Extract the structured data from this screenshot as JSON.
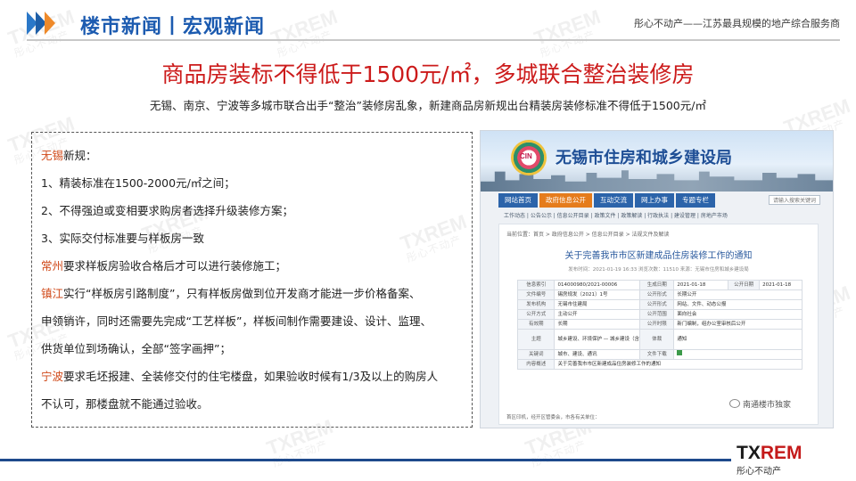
{
  "header": {
    "title": "楼市新闻丨宏观新闻",
    "slogan": "彤心不动产——江苏最具规模的地产综合服务商"
  },
  "main_title": "商品房装标不得低于1500元/㎡，多城联合整治装修房",
  "subtitle": "无锡、南京、宁波等多城市联合出手“整治”装修房乱象，新建商品房新规出台精装房装修标准不得低于1500元/㎡",
  "content": {
    "lines": [
      {
        "city": "无锡",
        "text": "新规："
      },
      {
        "city": "",
        "text": "1、精装标准在1500-2000元/㎡之间；"
      },
      {
        "city": "",
        "text": "2、不得强迫或变相要求购房者选择升级装修方案；"
      },
      {
        "city": "",
        "text": "3、实际交付标准要与样板房一致"
      },
      {
        "city": "常州",
        "text": "要求样板房验收合格后才可以进行装修施工；"
      },
      {
        "city": "镇江",
        "text": "实行“样板房引路制度”，只有样板房做到位开发商才能进一步价格备案、"
      },
      {
        "city": "",
        "text": "申领销许，同时还需要先完成“工艺样板”，样板间制作需要建设、设计、监理、"
      },
      {
        "city": "",
        "text": "供货单位到场确认，全部“签字画押”；"
      },
      {
        "city": "宁波",
        "text": "要求毛坯报建、全装修交付的住宅楼盘，如果验收时候有1/3及以上的购房人"
      },
      {
        "city": "",
        "text": "不认可，那楼盘就不能通过验收。"
      }
    ]
  },
  "screenshot": {
    "logo_text": "CIN",
    "site_title": "无锡市住房和城乡建设局",
    "nav": [
      "网站首页",
      "政府信息公开",
      "互动交流",
      "网上办事",
      "专题专栏"
    ],
    "search_placeholder": "请输入搜索关键词",
    "subnav": "工作动态 | 公告公示 | 信息公开目录 | 政策文件 | 政策解读 | 行政执法 | 建设管理 | 房地产市场",
    "breadcrumb": "当前位置：首页 > 政府信息公开 > 信息公开目录 > 法规文件及解读",
    "notice_title": "关于完善我市市区新建成品住房装修工作的通知",
    "meta": "发布时间：2021-01-19 16:33   浏览次数：11510   来源：无锡市住房和城乡建设局",
    "table": [
      [
        "信息索引",
        "014000980/2021-00006",
        "生成日期",
        "2021-01-18",
        "公开日期",
        "2021-01-18"
      ],
      [
        "文件编号",
        "锡房规发〔2021〕1号",
        "公开形式",
        "长期公开",
        "",
        ""
      ],
      [
        "发布机构",
        "无锡市住建局",
        "公开形式",
        "网站、文件、动态公报",
        "",
        ""
      ],
      [
        "公开方式",
        "主动公开",
        "公开范围",
        "面向社会",
        "",
        ""
      ],
      [
        "有效期",
        "长期",
        "公开时限",
        "新门编制，组办公室审核后公开",
        "",
        ""
      ],
      [
        "主题",
        "城乡建设、环境保护 — 城乡建设（含住房）",
        "体裁",
        "通知",
        "",
        ""
      ],
      [
        "关键词",
        "城市、建设、通讯",
        "文件下载",
        "",
        "",
        ""
      ],
      [
        "内容概述",
        "关于完善我市市区新建成品住房装修工作的通知",
        "",
        "",
        "",
        ""
      ]
    ],
    "footer": "首区印机，经开区管委会，市各有关单位："
  },
  "credit": "南通楼市独家",
  "brand": {
    "name_a": "TX",
    "name_b": "REM",
    "sub": "彤心不动产"
  }
}
